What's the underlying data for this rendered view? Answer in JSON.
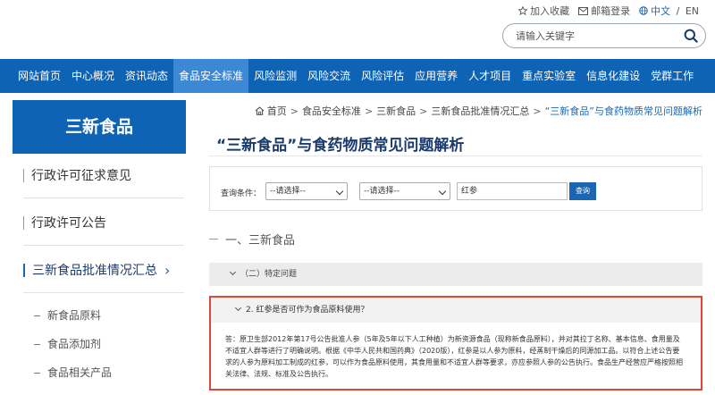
{
  "header": {
    "links": [
      {
        "label": "加入收藏",
        "icon": "star-icon"
      },
      {
        "label": "邮箱登录",
        "icon": "mail-icon"
      }
    ],
    "lang": {
      "zh": "中文",
      "sep": " / ",
      "en": "EN",
      "icon": "globe-icon"
    },
    "search": {
      "placeholder": "请输入关键字",
      "icon": "search-icon"
    }
  },
  "nav": {
    "items": [
      "网站首页",
      "中心概况",
      "资讯动态",
      "食品安全标准",
      "风险监测",
      "风险交流",
      "风险评估",
      "应用营养",
      "人才项目",
      "重点实验室",
      "信息化建设",
      "党群工作"
    ],
    "active_index": 3
  },
  "sidebar": {
    "title": "三新食品",
    "items": [
      "行政许可征求意见",
      "行政许可公告",
      "三新食品批准情况汇总"
    ],
    "current_index": 2,
    "chevron": "›",
    "subitems": [
      "新食品原料",
      "食品添加剂",
      "食品相关产品"
    ]
  },
  "breadcrumb": {
    "home_icon": "home-icon",
    "items": [
      "首页",
      "食品安全标准",
      "三新食品",
      "三新食品批准情况汇总",
      "“三新食品”与食药物质常见问题解析"
    ],
    "separator": ">"
  },
  "page": {
    "title": "“三新食品”与食药物质常见问题解析"
  },
  "filter": {
    "label": "查询条件：",
    "select1": "--请选择--",
    "select2": "--请选择--",
    "keyword": "红参",
    "button": "查询"
  },
  "section": {
    "title": "一、三新食品",
    "subheading": "（二）特定问题",
    "question": "2. 红参是否可作为食品原料使用？",
    "answer": "答：原卫生部2012年第17号公告批准人参（5年及5年以下人工种植）为新资源食品（现称新食品原料），并对其拉丁名称、基本信息、食用量及不适宜人群等进行了明确说明。根据《中华人民共和国药典》（2020版），红参是以人参为原料，经蒸制干燥后的同源加工品。以符合上述公告要求的人参为原料加工制成的红参，可以作为食品原料使用，其食用量和不适宜人群等要求，亦应参照人参的公告执行。食品生产经营应严格按照相关法律、法规、标准及公告执行。"
  },
  "colors": {
    "brand_blue": "#0f63b4",
    "nav_active": "#3c88d4",
    "highlight_red": "#e14638",
    "title_navy": "#1a3a6b"
  }
}
